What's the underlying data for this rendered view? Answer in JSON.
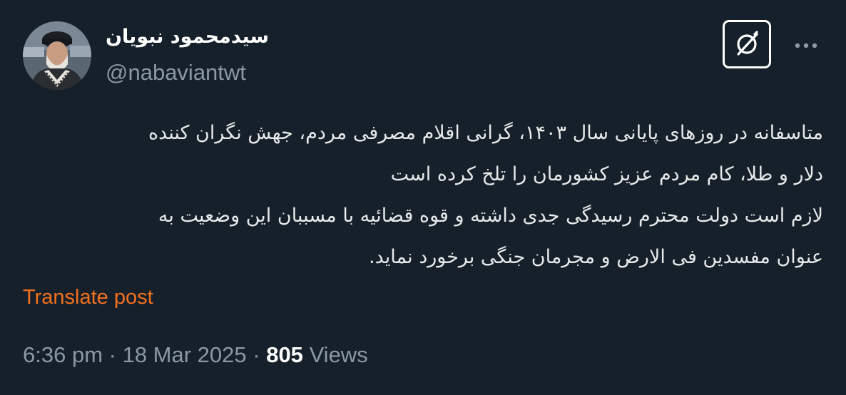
{
  "author": {
    "display_name": "سیدمحمود نبویان",
    "username": "@nabaviantwt",
    "avatar": "profile-photo"
  },
  "header": {
    "grok_icon": "grok-icon",
    "more_icon": "more-horizontal-icon"
  },
  "tweet": {
    "lines": [
      "متاسفانه در روزهای پایانی سال ۱۴۰۳، گرانی اقلام مصرفی مردم، جهش نگران کننده",
      "دلار و طلا، کام مردم عزیز کشورمان را تلخ کرده است",
      "لازم است دولت محترم رسیدگی جدی داشته و قوه قضائیه با مسببان این وضعیت به",
      "عنوان مفسدین فی الارض و مجرمان جنگی برخورد نماید."
    ]
  },
  "translate_label": "Translate post",
  "meta": {
    "time": "6:36 pm",
    "separator": " · ",
    "date": "18 Mar 2025",
    "views_count": "805",
    "views_label": "Views"
  },
  "colors": {
    "background": "#15202b",
    "text": "#e7e9ea",
    "secondary": "#8b98a5",
    "translate": "#f4711c"
  }
}
